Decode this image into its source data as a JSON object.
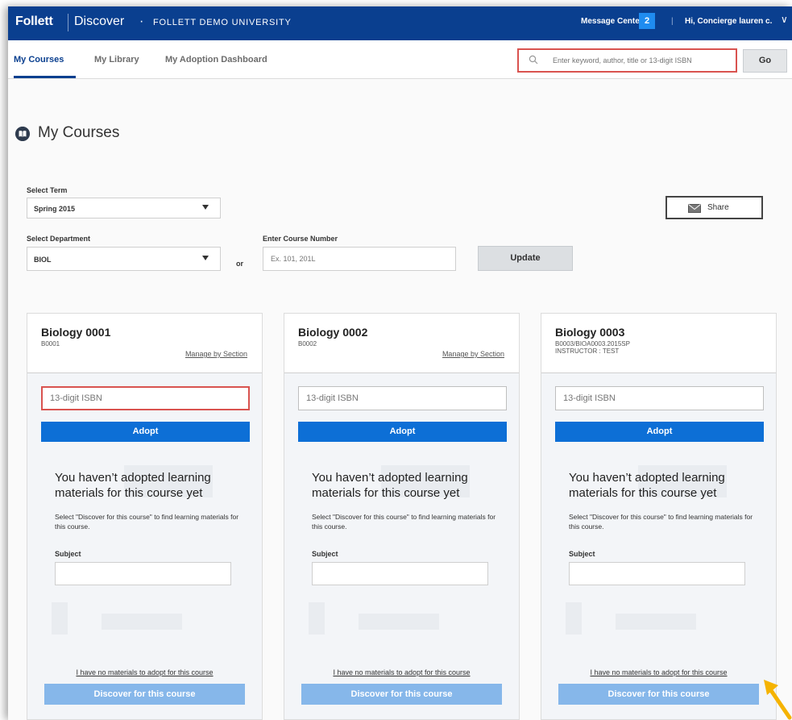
{
  "topbar": {
    "brand": "Follett",
    "product": "Discover",
    "separator": "·",
    "university": "FOLLETT DEMO UNIVERSITY",
    "message_center_label": "Message Center",
    "message_count": "2",
    "divider": "|",
    "greeting": "Hi, Concierge lauren c.",
    "greeting_chevron": "∨"
  },
  "nav": {
    "tabs": [
      {
        "label": "My Courses"
      },
      {
        "label": "My Library"
      },
      {
        "label": "My Adoption Dashboard"
      }
    ],
    "search_placeholder": "Enter keyword, author, title or 13-digit ISBN",
    "go_label": "Go"
  },
  "page": {
    "title": "My Courses"
  },
  "filters": {
    "term_label": "Select Term",
    "term_value": "Spring 2015",
    "department_label": "Select Department",
    "department_value": "BIOL",
    "or_label": "or",
    "course_number_label": "Enter Course Number",
    "course_number_placeholder": "Ex. 101, 201L",
    "update_label": "Update",
    "share_label": "Share"
  },
  "cards": [
    {
      "title": "Biology 0001",
      "code": "B0001",
      "instructor": "",
      "manage_link": "Manage by Section",
      "isbn_placeholder": "13-digit ISBN",
      "adopt_label": "Adopt",
      "empty_title": "You haven’t adopted learning materials for this course yet",
      "empty_text": "Select \"Discover for this course\" to find learning materials for this course.",
      "subject_label": "Subject",
      "no_materials_link": "I have no materials to adopt for this course",
      "discover_label": "Discover for this course"
    },
    {
      "title": "Biology 0002",
      "code": "B0002",
      "instructor": "",
      "manage_link": "Manage by Section",
      "isbn_placeholder": "13-digit ISBN",
      "adopt_label": "Adopt",
      "empty_title": "You haven’t adopted learning materials for this course yet",
      "empty_text": "Select \"Discover for this course\" to find learning materials for this course.",
      "subject_label": "Subject",
      "no_materials_link": "I have no materials to adopt for this course",
      "discover_label": "Discover for this course"
    },
    {
      "title": "Biology 0003",
      "code": "B0003/BIOA0003.2015SP",
      "instructor": "INSTRUCTOR : TEST",
      "manage_link": "",
      "isbn_placeholder": "13-digit ISBN",
      "adopt_label": "Adopt",
      "empty_title": "You haven’t adopted learning materials for this course yet",
      "empty_text": "Select \"Discover for this course\" to find learning materials for this course.",
      "subject_label": "Subject",
      "no_materials_link": "I have no materials to adopt for this course",
      "discover_label": "Discover for this course"
    }
  ],
  "colors": {
    "brand_blue": "#0a3f8f",
    "badge_blue": "#1f8cf0",
    "adopt_blue": "#0d6fd6",
    "discover_blue": "#86b7ea",
    "highlight_red": "#d9534f",
    "pointer_yellow": "#f5b301"
  }
}
